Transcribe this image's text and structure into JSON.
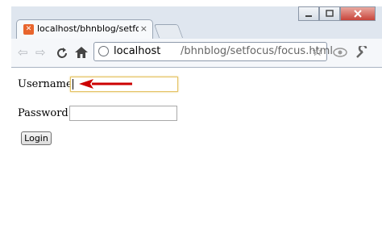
{
  "browser": {
    "tab_title": "localhost/bhnblog/setfocus",
    "tab_close": "×",
    "url_host": "localhost",
    "url_path": "/bhnblog/setfocus/focus.html",
    "colors": {
      "favicon": "#e8652d",
      "focus_border": "#e5c365",
      "arrow": "#cc0000"
    }
  },
  "form": {
    "username_label": "Username :",
    "username_value": "",
    "password_label": "Password :",
    "password_value": "",
    "login_label": "Login"
  }
}
